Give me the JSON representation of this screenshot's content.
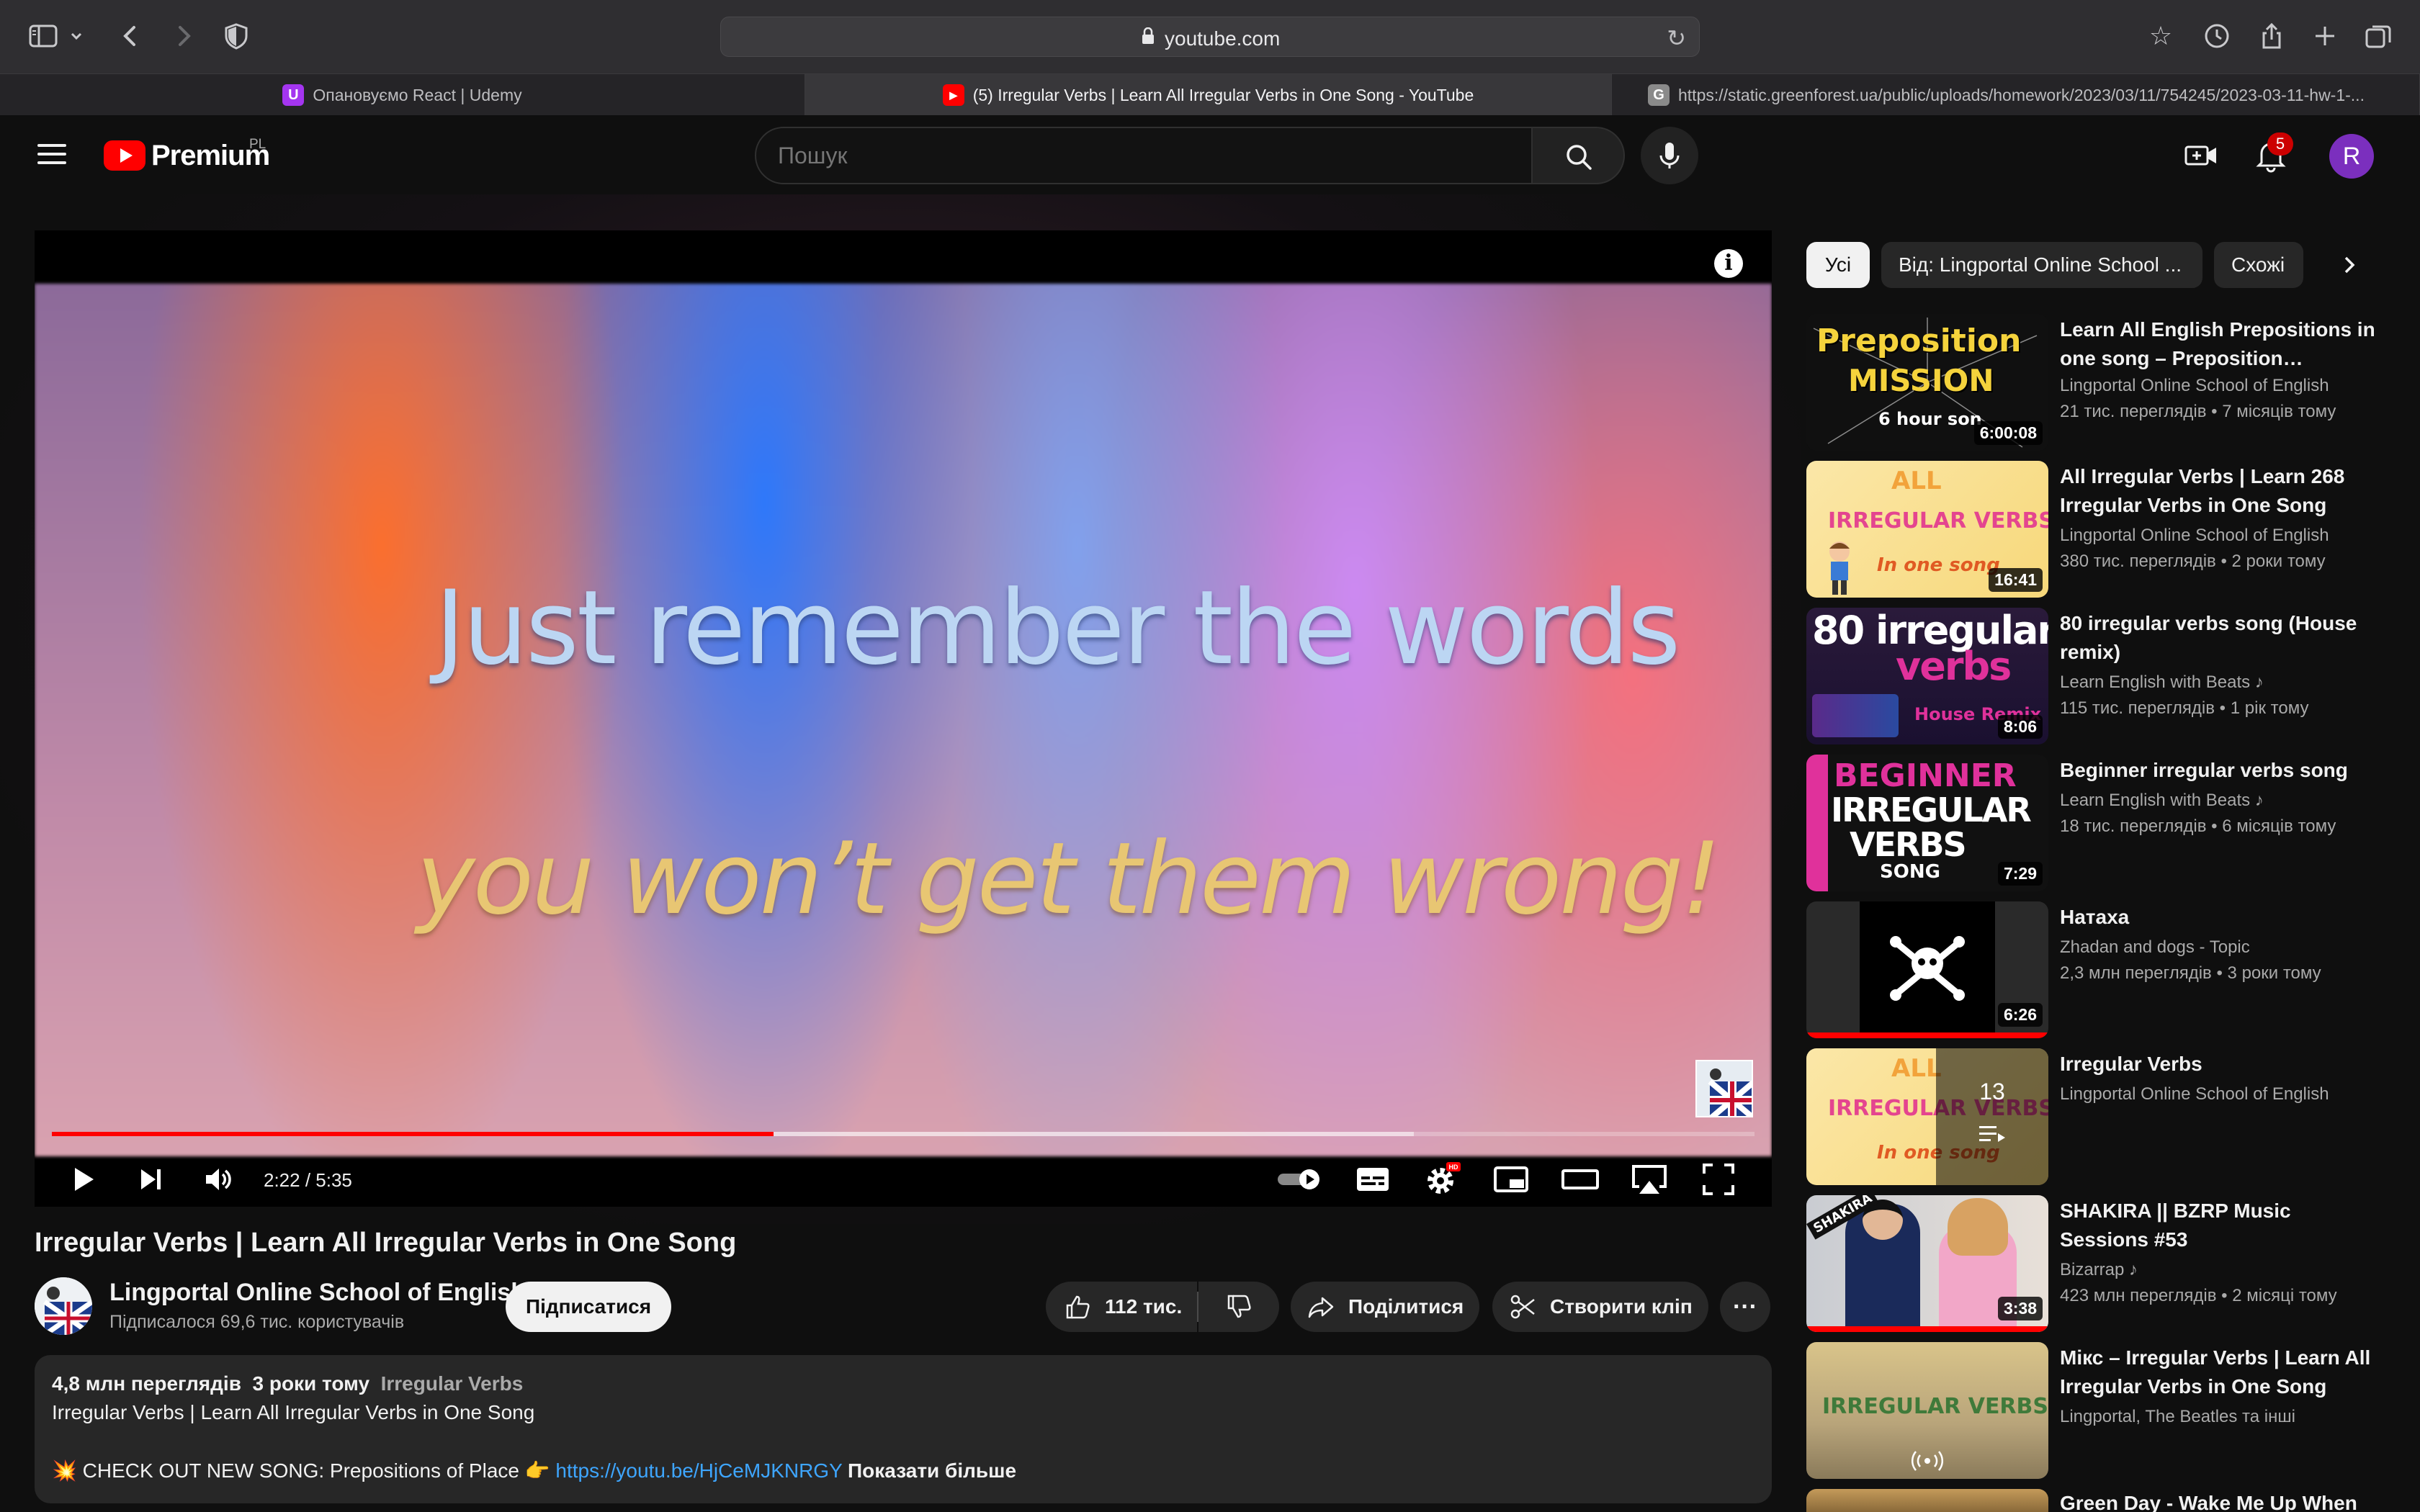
{
  "browser": {
    "url": "youtube.com",
    "tabs": [
      {
        "label": "Опановуємо React | Udemy",
        "favicon_color": "#a435f0",
        "favicon_glyph": "U"
      },
      {
        "label": "(5) Irregular Verbs | Learn All Irregular Verbs in One Song - YouTube",
        "favicon_color": "#ff0000",
        "favicon_glyph": "▶"
      },
      {
        "label": "https://static.greenforest.ua/public/uploads/homework/2023/03/11/754245/2023-03-11-hw-1-...",
        "favicon_color": "#8a8a8a",
        "favicon_glyph": "G"
      }
    ],
    "icons": [
      "sidebar-icon",
      "chevron-down-icon",
      "back-icon",
      "forward-icon",
      "shield-icon",
      "star-icon",
      "history-icon",
      "share-icon",
      "new-tab-icon",
      "tabs-overview-icon"
    ]
  },
  "header": {
    "logo_text": "Premium",
    "country_code": "PL",
    "search_placeholder": "Пошук",
    "notifications_count": "5",
    "avatar_letter": "R"
  },
  "player": {
    "lyric_line1": "Just remember the words",
    "lyric_line2": "you won’t get them wrong!",
    "time_display": "2:22 / 5:35",
    "played_fraction": 0.424,
    "buffered_fraction": 0.8,
    "info_glyph": "i"
  },
  "video": {
    "title": "Irregular Verbs | Learn All Irregular Verbs in One Song",
    "channel_name": "Lingportal Online School of English",
    "subscribers": "Підписалося 69,6 тис. користувачів",
    "subscribe_label": "Підписатися",
    "likes": "112 тис.",
    "share_label": "Поділитися",
    "clip_label": "Створити кліп",
    "more_glyph": "···"
  },
  "description": {
    "views": "4,8 млн переглядів",
    "age": "3 роки тому",
    "tag": "Irregular Verbs",
    "line1": "Irregular Verbs | Learn All Irregular Verbs in One Song",
    "line2_prefix": "💥  CHECK OUT NEW SONG:  Prepositions of Place  👉 ",
    "link": "https://youtu.be/HjCeMJKNRGY",
    "show_more": "Показати більше"
  },
  "chips": [
    "Усі",
    "Від: Lingportal Online School ...",
    "Схожі"
  ],
  "recommendations": [
    {
      "title": "Learn All English Prepositions in one song – Preposition…",
      "channel": "Lingportal Online School of English",
      "meta": "21 тис. переглядів  • 7 місяців тому",
      "duration": "6:00:08",
      "thumb_text": "Preposition",
      "thumb_text2": "MISSION",
      "thumb_text3": "6 hour son"
    },
    {
      "title": "All Irregular Verbs | Learn 268 Irregular Verbs in One Song",
      "channel": "Lingportal Online School of English",
      "meta": "380 тис. переглядів  • 2 роки тому",
      "duration": "16:41",
      "thumb_text": "ALL",
      "thumb_text2": "IRREGULAR VERBS",
      "thumb_text3": "In one song"
    },
    {
      "title": "80 irregular verbs song (House remix)",
      "channel": "Learn English with Beats  ♪",
      "meta": "115 тис. переглядів  • 1 рік тому",
      "duration": "8:06",
      "thumb_text": "80 irregular",
      "thumb_text2": "verbs",
      "thumb_text3": "House Remix"
    },
    {
      "title": "Beginner irregular verbs song",
      "channel": "Learn English with Beats  ♪",
      "meta": "18 тис. переглядів  • 6 місяців тому",
      "duration": "7:29",
      "thumb_text": "BEGINNER",
      "thumb_text2": "IRREGULAR",
      "thumb_text3": "VERBS",
      "thumb_text4": "SONG"
    },
    {
      "title": "Натаха",
      "channel": "Zhadan and dogs - Topic",
      "meta": "2,3 млн переглядів  • 3 роки тому",
      "duration": "6:26"
    },
    {
      "title": "Irregular Verbs",
      "channel": "Lingportal Online School of English",
      "meta": "",
      "playlist_count": "13",
      "thumb_text": "ALL",
      "thumb_text2": "IRREGULAR VERBS",
      "thumb_text3": "In one song"
    },
    {
      "title": "SHAKIRA || BZRP Music Sessions #53",
      "channel": "Bizarrap  ♪",
      "meta": "423 млн переглядів  • 2 місяці тому",
      "duration": "3:38",
      "thumb_text": "SHAKIRA"
    },
    {
      "title": "Мікс – Irregular Verbs | Learn All Irregular Verbs in One Song",
      "channel": "Lingportal, The Beatles та інші",
      "meta": "",
      "thumb_text": "IRREGULAR VERBS"
    },
    {
      "title": "Green Day - Wake Me Up When",
      "channel": "",
      "meta": ""
    }
  ]
}
